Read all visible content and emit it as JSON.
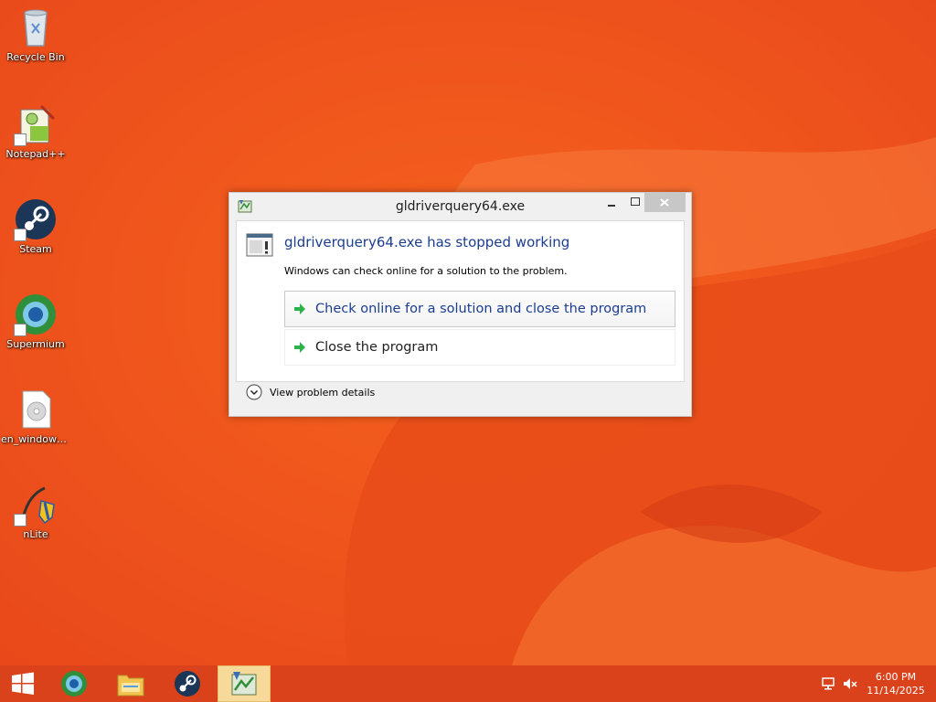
{
  "desktop": {
    "icons": [
      {
        "label": "Recycle Bin",
        "icon": "recycle-bin-icon"
      },
      {
        "label": "Notepad++",
        "icon": "notepad-plus-plus-icon"
      },
      {
        "label": "Steam",
        "icon": "steam-icon"
      },
      {
        "label": "Supermium",
        "icon": "supermium-icon"
      },
      {
        "label": "en_windows...",
        "icon": "disc-image-icon"
      },
      {
        "label": "nLite",
        "icon": "nlite-icon"
      }
    ]
  },
  "dialog": {
    "title": "gldriverquery64.exe",
    "main_instruction": "gldriverquery64.exe has stopped working",
    "content": "Windows can check online for a solution to the problem.",
    "commands": [
      {
        "label": "Check online for a solution and close the program"
      },
      {
        "label": "Close the program"
      }
    ],
    "details_label": "View problem details"
  },
  "taskbar": {
    "items": [
      "start-icon",
      "supermium-icon",
      "file-explorer-icon",
      "steam-icon",
      "error-reporting-icon"
    ],
    "clock": {
      "time": "6:00 PM",
      "date": "11/14/2025"
    }
  },
  "colors": {
    "wallpaper": "#f0581c",
    "taskbar": "#d9421a",
    "link_blue": "#1b3d8f",
    "active_task": "#f7d99a"
  }
}
